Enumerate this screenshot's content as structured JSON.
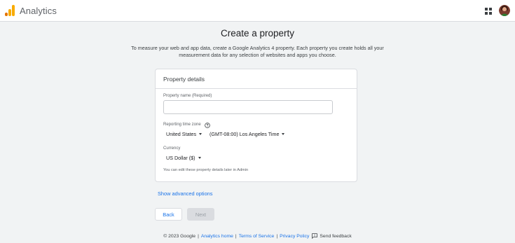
{
  "header": {
    "app_title": "Analytics",
    "icons": [
      "analytics-logo-icon",
      "apps-grid-icon",
      "avatar"
    ]
  },
  "page": {
    "title": "Create a property",
    "intro": "To measure your web and app data, create a Google Analytics 4 property. Each property you create holds all your measurement data for any selection of websites and apps you choose."
  },
  "card": {
    "title": "Property details",
    "property_name_label": "Property name (Required)",
    "property_name_value": "",
    "timezone_label": "Reporting time zone",
    "country_select": "United States",
    "timezone_select": "(GMT-08:00) Los Angeles Time",
    "currency_label": "Currency",
    "currency_select": "US Dollar ($)",
    "hint": "You can edit these property details later in Admin"
  },
  "actions": {
    "advanced_link": "Show advanced options",
    "back_label": "Back",
    "next_label": "Next"
  },
  "footer": {
    "copyright": "© 2023 Google",
    "separator": "|",
    "links": [
      "Analytics home",
      "Terms of Service",
      "Privacy Policy"
    ],
    "feedback": "Send feedback"
  },
  "colors": {
    "accent": "#1a73e8",
    "logo_orange": "#f9ab00",
    "logo_dark_orange": "#e37400",
    "background": "#f1f3f4"
  }
}
